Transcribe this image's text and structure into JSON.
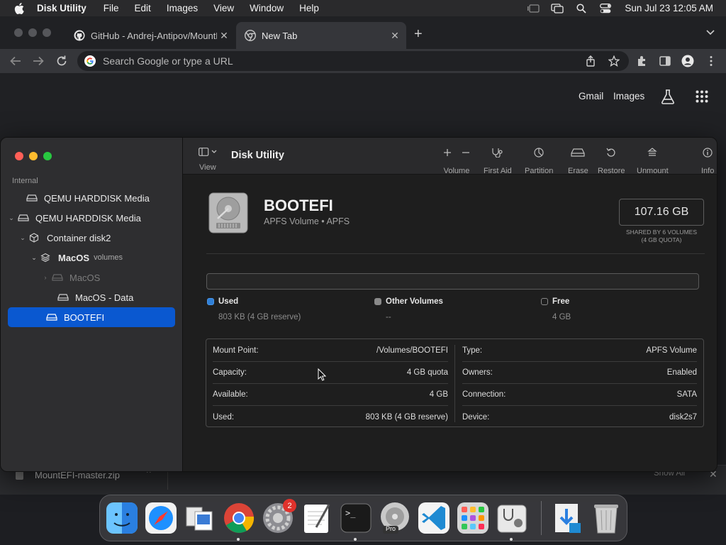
{
  "menubar": {
    "app_name": "Disk Utility",
    "items": [
      "File",
      "Edit",
      "Images",
      "View",
      "Window",
      "Help"
    ],
    "clock": "Sun Jul 23  12:05 AM"
  },
  "browser": {
    "tabs": [
      {
        "title": "GitHub - Andrej-Antipov/MountEFI",
        "active": false
      },
      {
        "title": "New Tab",
        "active": true
      }
    ],
    "omnibox_placeholder": "Search Google or type a URL",
    "ntp_links": {
      "gmail": "Gmail",
      "images": "Images"
    }
  },
  "downloads": {
    "file": "MountEFI-master.zip",
    "show_all": "Show All"
  },
  "disk_utility": {
    "window_title": "Disk Utility",
    "view_label": "View",
    "sidebar": {
      "section": "Internal",
      "items": [
        {
          "label": "QEMU HARDDISK Media",
          "sub": ""
        },
        {
          "label": "QEMU HARDDISK Media",
          "sub": ""
        },
        {
          "label": "Container disk2",
          "sub": ""
        },
        {
          "label": "MacOS",
          "sub": "volumes"
        },
        {
          "label": "MacOS",
          "sub": ""
        },
        {
          "label": "MacOS - Data",
          "sub": ""
        },
        {
          "label": "BOOTEFI",
          "sub": ""
        }
      ]
    },
    "toolbar": {
      "volume": "Volume",
      "first_aid": "First Aid",
      "partition": "Partition",
      "erase": "Erase",
      "restore": "Restore",
      "unmount": "Unmount",
      "info": "Info"
    },
    "volume": {
      "name": "BOOTEFI",
      "subtitle": "APFS Volume • APFS",
      "capacity": "107.16 GB",
      "capacity_note_1": "SHARED BY 6 VOLUMES",
      "capacity_note_2": "(4 GB QUOTA)"
    },
    "legend": [
      {
        "label": "Used",
        "value": "803 KB (4 GB reserve)",
        "color": "#2f80d8"
      },
      {
        "label": "Other Volumes",
        "value": "--",
        "color": "#8a8a8a"
      },
      {
        "label": "Free",
        "value": "4 GB",
        "color": "#1e1e1e"
      }
    ],
    "info_left": [
      {
        "key": "Mount Point:",
        "value": "/Volumes/BOOTEFI"
      },
      {
        "key": "Capacity:",
        "value": "4 GB quota"
      },
      {
        "key": "Available:",
        "value": "4 GB"
      },
      {
        "key": "Used:",
        "value": "803 KB (4 GB reserve)"
      }
    ],
    "info_right": [
      {
        "key": "Type:",
        "value": "APFS Volume"
      },
      {
        "key": "Owners:",
        "value": "Enabled"
      },
      {
        "key": "Connection:",
        "value": "SATA"
      },
      {
        "key": "Device:",
        "value": "disk2s7"
      }
    ]
  },
  "dock": {
    "settings_badge": "2",
    "pro_label": "Pro"
  },
  "colors": {
    "selection": "#0a58d0",
    "close": "#ff5f57",
    "minimize": "#febc2e",
    "zoom": "#28c840"
  }
}
